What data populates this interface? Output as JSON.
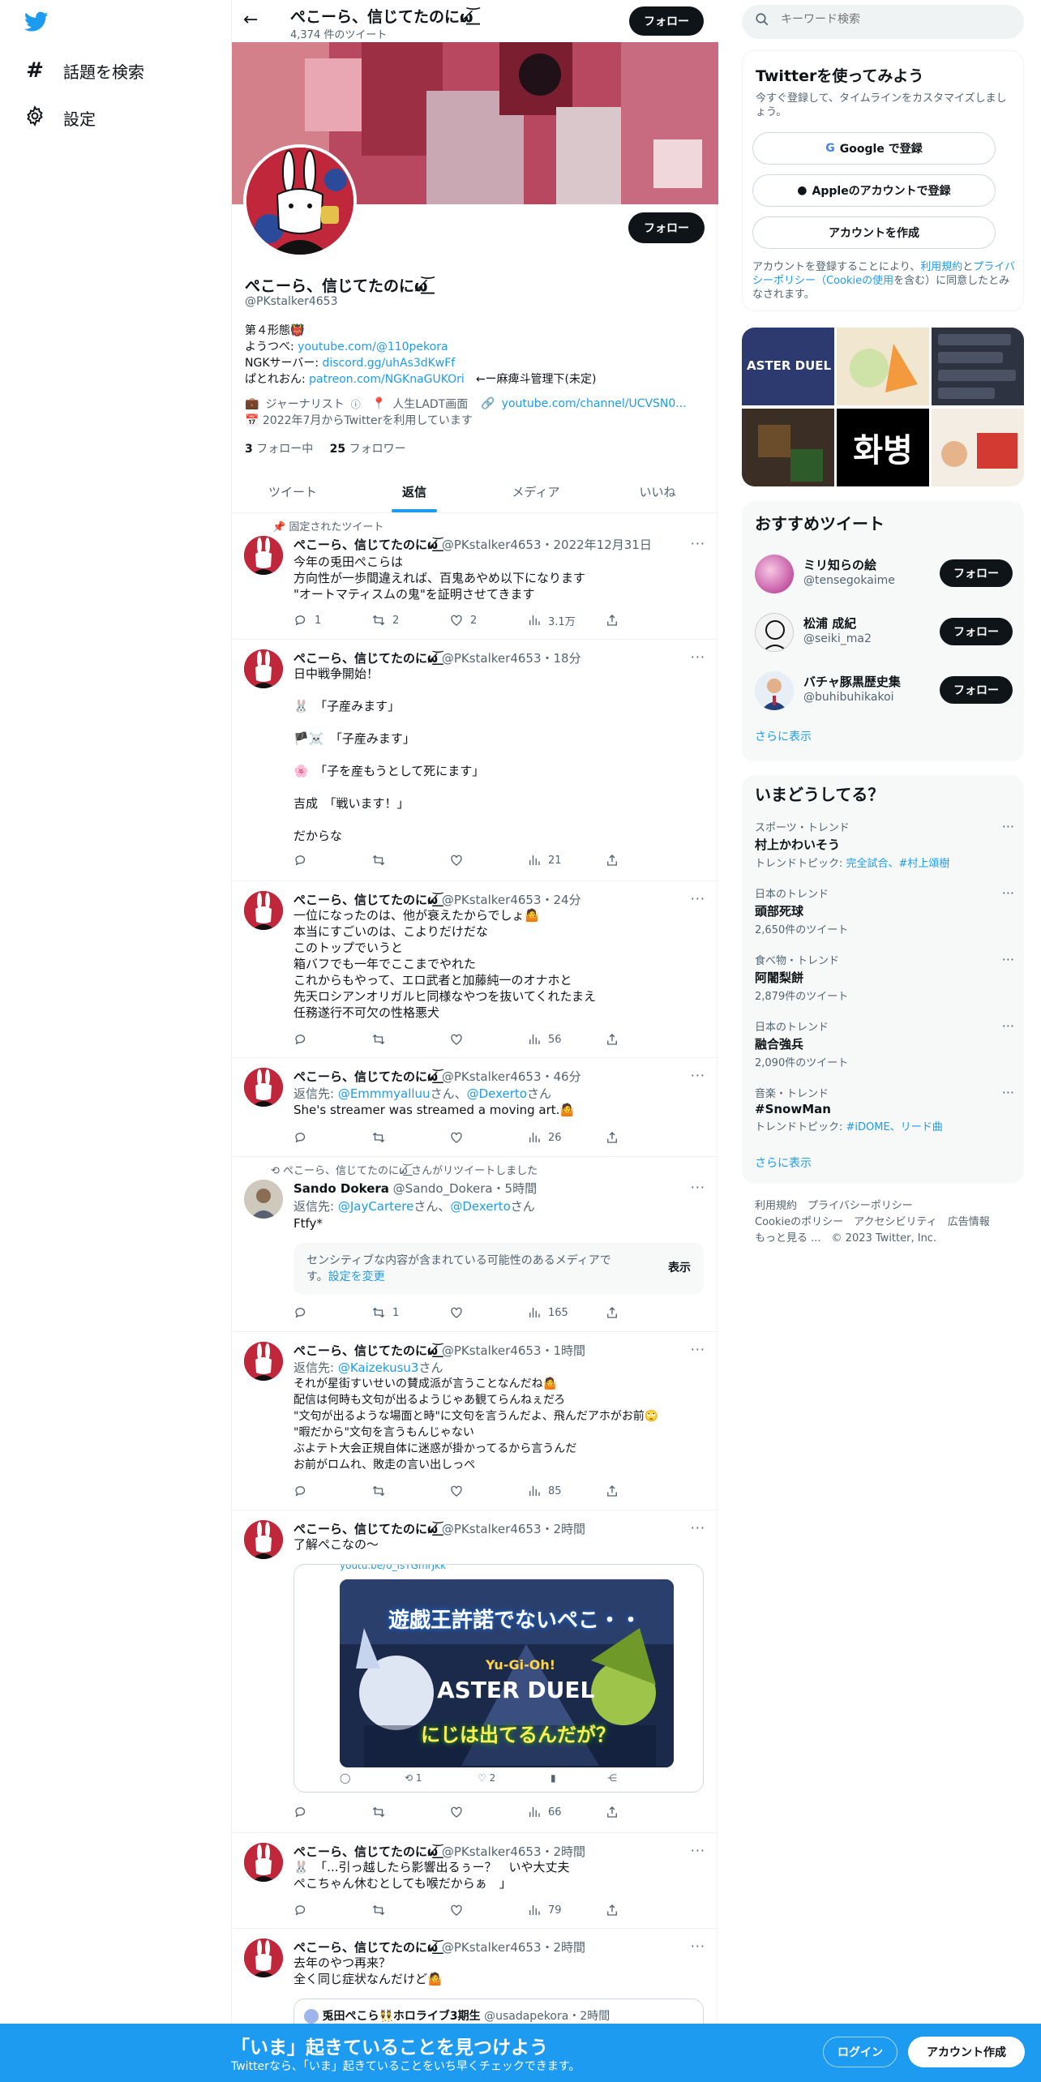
{
  "nav": {
    "items": [
      {
        "label": "話題を検索",
        "icon": "hashtag-icon"
      },
      {
        "label": "設定",
        "icon": "gear-icon"
      }
    ]
  },
  "header": {
    "title": "ぺこーら、信じてたのにω̸͝͏͏͟͟",
    "tweet_count": "4,374 件のツイート",
    "follow_label": "フォロー"
  },
  "profile": {
    "name": "ぺこーら、信じてたのにω̸͝͏͏͟͟",
    "handle": "@PKstalker4653",
    "follow_label": "フォロー",
    "bio_line1": "第４形態👹",
    "bio_youtube_label": "ようつべ: ",
    "bio_youtube_link": "youtube.com/@110pekora",
    "bio_discord_label": "NGKサーバー: ",
    "bio_discord_link": "discord.gg/uhAs3dKwFf",
    "bio_patreon_label": "ぱとれおん: ",
    "bio_patreon_link": "patreon.com/NGKnaGUKOri",
    "bio_patreon_suffix": "←ー麻痺斗管理下(未定)",
    "category": "ジャーナリスト",
    "location": "人生LADT画面",
    "website": "youtube.com/channel/UCVSN0...",
    "joined": "2022年7月からTwitterを利用しています",
    "following_count": "3",
    "following_label": "フォロー中",
    "followers_count": "25",
    "followers_label": "フォロワー"
  },
  "tabs": [
    "ツイート",
    "返信",
    "メディア",
    "いいね"
  ],
  "active_tab": "返信",
  "tweets": {
    "t1": {
      "pinned_label": "固定されたツイート",
      "name": "ぺこーら、信じてたのにω̸͝͏͏͟͟",
      "meta": "@PKstalker4653・2022年12月31日",
      "text": "今年の兎田ぺこらは\n方向性が一歩間違えれば、百鬼あやめ以下になります\n\"オートマティスムの鬼\"を証明させてきます",
      "reply": "1",
      "retweet": "2",
      "like": "2",
      "views": "3.1万"
    },
    "t2": {
      "name": "ぺこーら、信じてたのにω̸͝͏͏͟͟",
      "meta": "@PKstalker4653・18分",
      "text": "日中戦争開始！\n\n🐰　「子産みます」\n\n🏴☠️　「子産みます」\n\n🌸　「子を産もうとして死にます」\n\n吉成　「戦います！」\n\nだからな",
      "views": "21"
    },
    "t3": {
      "name": "ぺこーら、信じてたのにω̸͝͏͏͟͟",
      "meta": "@PKstalker4653・24分",
      "text": "一位になったのは、他が衰えたからでしょ🤷\n本当にすごいのは、こよりだけだな\nこのトップでいうと\n箱バフでも一年でここまでやれた\nこれからもやって、エロ武者と加藤純一のオナホと\n先天ロシアンオリガルヒ同様なやつを抜いてくれたまえ\n任務遂行不可欠の性格悪犬",
      "views": "56"
    },
    "t4": {
      "name": "ぺこーら、信じてたのにω̸͝͏͏͟͟",
      "meta": "@PKstalker4653・46分",
      "reply_prefix": "返信先: ",
      "reply_to1": "@Emmmyalluu",
      "reply_mid": "さん、",
      "reply_to2": "@Dexerto",
      "reply_suffix": "さん",
      "text": "She's streamer was streamed a moving art.🤷",
      "views": "26"
    },
    "t5": {
      "retweeted_by": "ぺこーら、信じてたのにω̸͝͏͏͟͟ さんがリツイートしました",
      "name": "Sando Dokera",
      "meta": "@Sando_Dokera・5時間",
      "reply_prefix": "返信先: ",
      "reply_to1": "@JayCartere",
      "reply_mid": "さん、",
      "reply_to2": "@Dexerto",
      "reply_suffix": "さん",
      "text": "Ftfy*",
      "sensitive_text": "センシティブな内容が含まれている可能性のあるメディアです。",
      "sensitive_link": "設定を変更",
      "show_label": "表示",
      "retweet": "1",
      "views": "165"
    },
    "t6": {
      "name": "ぺこーら、信じてたのにω̸͝͏͏͟͟",
      "meta": "@PKstalker4653・1時間",
      "reply_prefix": "返信先: ",
      "reply_to1": "@Kaizekusu3",
      "reply_suffix": "さん",
      "text": "それが星街すいせいの賛成派が言うことなんだね🤷\n配信は何時も文句が出るようじゃあ観てらんねぇだろ\n\"文句が出るような場面と時\"に文句を言うんだよ、飛んだアホがお前🙄\n\"暇だから\"文句を言うもんじゃない\nぶよテト大会正規自体に迷惑が掛かってるから言うんだ\nお前がロムれ、敗走の言い出しっぺ",
      "views": "85"
    },
    "t7": {
      "name": "ぺこーら、信じてたのにω̸͝͏͏͟͟",
      "meta": "@PKstalker4653・2時間",
      "text": "了解ぺこなの〜",
      "embed_link": "youtu.be/o_IsTGmrJkk",
      "thumb_title": "遊戯王許諾でないペこ・・",
      "thumb_logo": "Yu-Gi-Oh!",
      "thumb_logo2": "ASTER DUEL",
      "thumb_sub": "にじは出てるんだが？",
      "embed_retweet": "1",
      "embed_like": "2",
      "views": "66"
    },
    "t8": {
      "name": "ぺこーら、信じてたのにω̸͝͏͏͟͟",
      "meta": "@PKstalker4653・2時間",
      "text": "🐰　「...引っ越したら影響出るぅー？　いや大丈夫\nぺこちゃん休むとしても喉だからぁ　」",
      "views": "79"
    },
    "t9": {
      "name": "ぺこーら、信じてたのにω̸͝͏͏͟͟",
      "meta": "@PKstalker4653・2時間",
      "text": "去年のやつ再来？\n全く同じ症状なんだけど🤷",
      "quote_name": "兎田ぺこら👯ホロライブ3期生",
      "quote_meta": "@usadapekora・2時間"
    }
  },
  "sidebar": {
    "search_placeholder": "キーワード検索",
    "signup": {
      "title": "Twitterを使ってみよう",
      "subtitle": "今すぐ登録して、タイムラインをカスタマイズしましょう。",
      "google_label": "Google で登録",
      "apple_label": "Appleのアカウントで登録",
      "create_label": "アカウントを作成",
      "legal_pre": "アカウントを登録することにより、",
      "legal_terms": "利用規約",
      "legal_and": "と",
      "legal_privacy": "プライバシーポリシー（Cookieの使用",
      "legal_post": "を含む）に同意したとみなされます。"
    },
    "media_grid": {
      "cell1_title": "ASTER DUEL",
      "cell5_text": "화병"
    },
    "suggest": {
      "title": "おすすめツイート",
      "users": [
        {
          "name": "ミリ知らの絵",
          "handle": "@tensegokaime",
          "follow": "フォロー"
        },
        {
          "name": "松浦 成紀",
          "handle": "@seiki_ma2",
          "follow": "フォロー"
        },
        {
          "name": "バチャ豚黒歴史集",
          "handle": "@buhibuhikakoi",
          "follow": "フォロー"
        }
      ],
      "more": "さらに表示"
    },
    "trends": {
      "title": "いまどうしてる？",
      "items": [
        {
          "cat": "スポーツ・トレンド",
          "name": "村上かわいそう",
          "sub_label": "トレンドトピック: ",
          "sub_links": "完全試合、#村上頌樹"
        },
        {
          "cat": "日本のトレンド",
          "name": "頭部死球",
          "sub": "2,650件のツイート"
        },
        {
          "cat": "食べ物・トレンド",
          "name": "阿闍梨餅",
          "sub": "2,879件のツイート"
        },
        {
          "cat": "日本のトレンド",
          "name": "融合強兵",
          "sub": "2,090件のツイート"
        },
        {
          "cat": "音楽・トレンド",
          "name": "#SnowMan",
          "sub_label": "トレンドトピック: ",
          "sub_links": "#iDOME、リード曲"
        }
      ],
      "more": "さらに表示"
    },
    "footer": {
      "line1a": "利用規約",
      "line1b": "プライバシーポリシー",
      "line2a": "Cookieのポリシー",
      "line2b": "アクセシビリティ",
      "line2c": "広告情報",
      "line3a": "もっと見る ...",
      "line3b": "© 2023 Twitter, Inc."
    }
  },
  "bottom_bar": {
    "title": "「いま」起きていることを見つけよう",
    "subtitle": "Twitterなら、「いま」起きていることをいち早くチェックできます。",
    "login_label": "ログイン",
    "signup_label": "アカウント作成"
  },
  "colors": {
    "accent": "#1d9bf0",
    "dark": "#0f1419",
    "gray": "#536471"
  }
}
